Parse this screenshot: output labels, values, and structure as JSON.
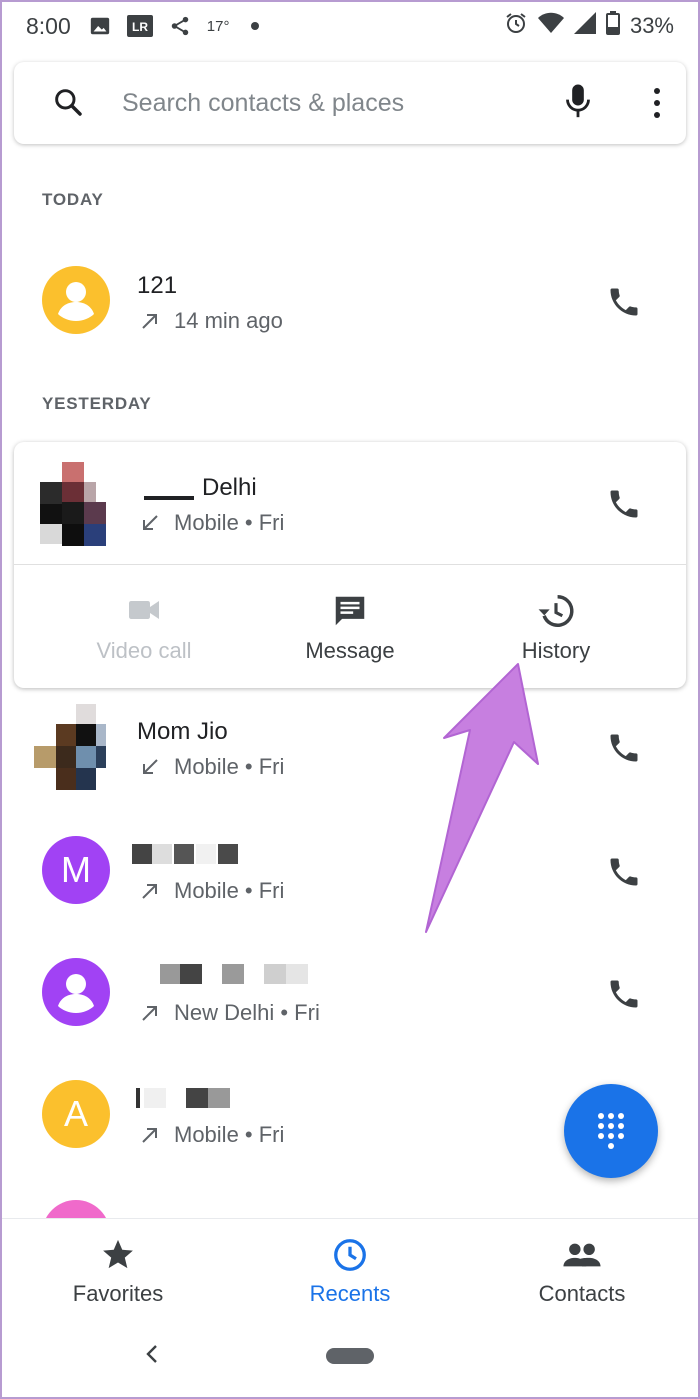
{
  "status_bar": {
    "time": "8:00",
    "temperature": "17°",
    "battery": "33%",
    "signal_r": "R"
  },
  "search": {
    "placeholder": "Search contacts & places"
  },
  "sections": {
    "today": "TODAY",
    "yesterday": "YESTERDAY"
  },
  "calls": [
    {
      "name": "121",
      "detail": "14 min ago",
      "direction": "outgoing",
      "avatar_color": "#fbc02d"
    },
    {
      "name": "Delhi",
      "detail": "Mobile • Fri",
      "direction": "incoming"
    },
    {
      "name": "Mom Jio",
      "detail": "Mobile • Fri",
      "direction": "incoming"
    },
    {
      "name": "",
      "detail": "Mobile • Fri",
      "direction": "outgoing",
      "avatar_letter": "M",
      "avatar_color": "#a142f4"
    },
    {
      "name": "",
      "detail": "New Delhi • Fri",
      "direction": "outgoing",
      "avatar_color": "#a142f4"
    },
    {
      "name": "",
      "detail": "Mobile • Fri",
      "direction": "outgoing",
      "avatar_letter": "A",
      "avatar_color": "#fbc02d"
    }
  ],
  "actions": {
    "video_call": "Video call",
    "message": "Message",
    "history": "History"
  },
  "nav": {
    "favorites": "Favorites",
    "recents": "Recents",
    "contacts": "Contacts"
  },
  "colors": {
    "accent": "#1a73e8",
    "annotation_arrow": "#c77fe0"
  }
}
